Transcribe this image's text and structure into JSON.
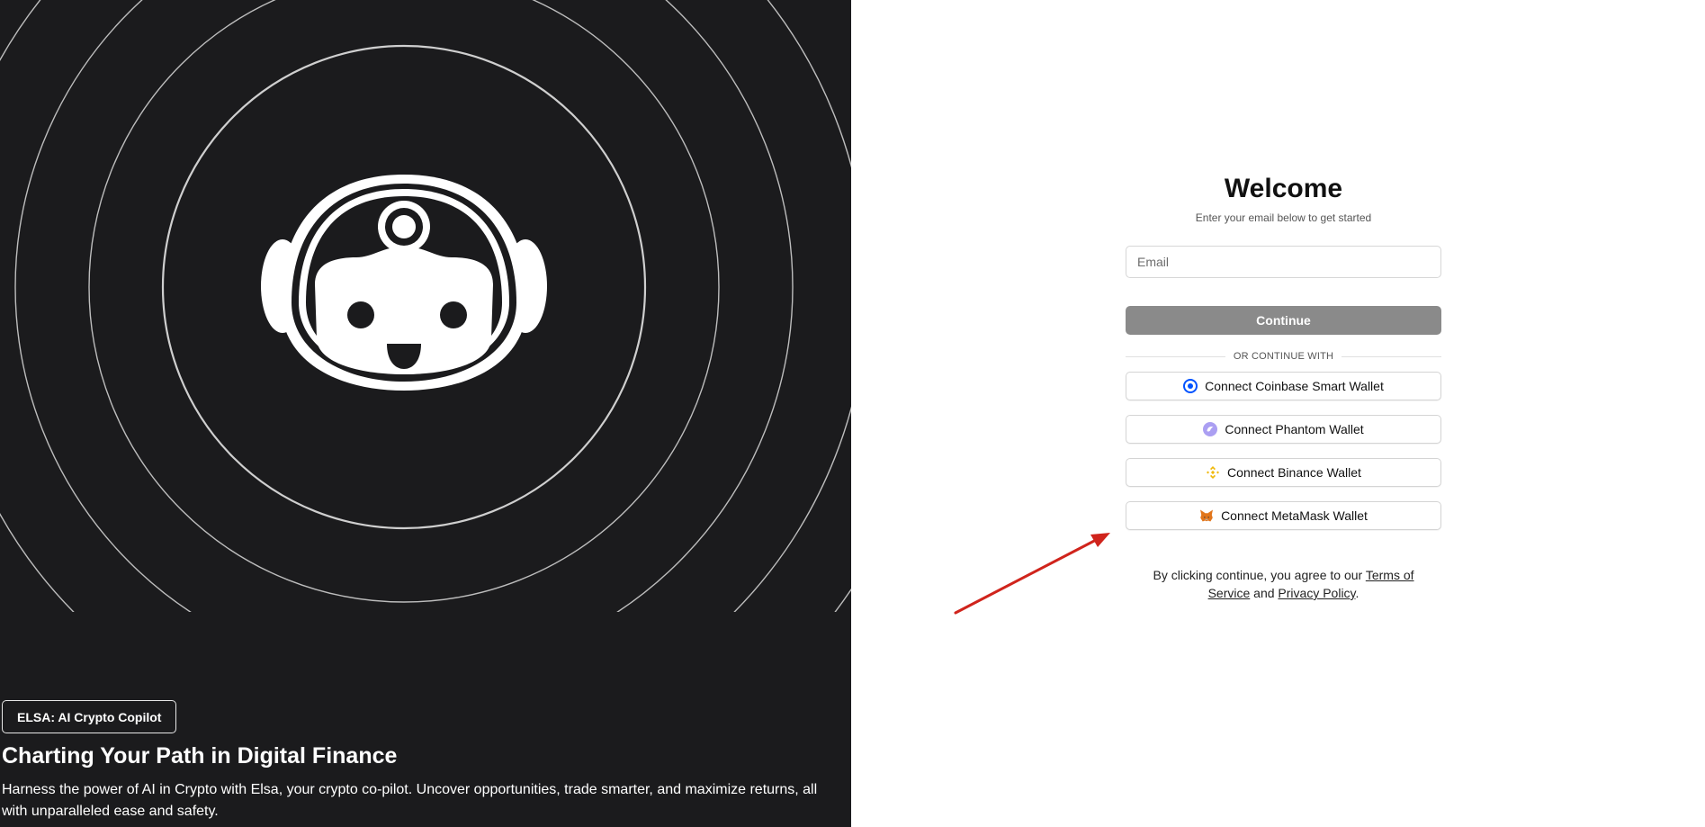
{
  "hero": {
    "badge": "ELSA: AI Crypto Copilot",
    "title": "Charting Your Path in Digital Finance",
    "description": "Harness the power of AI in Crypto with Elsa, your crypto co-pilot. Uncover opportunities, trade smarter, and maximize returns, all with unparalleled ease and safety."
  },
  "auth": {
    "title": "Welcome",
    "subtitle": "Enter your email below to get started",
    "email_placeholder": "Email",
    "continue_label": "Continue",
    "divider_label": "OR CONTINUE WITH",
    "wallets": [
      {
        "label": "Connect Coinbase Smart Wallet",
        "icon": "coinbase-icon"
      },
      {
        "label": "Connect Phantom Wallet",
        "icon": "phantom-icon"
      },
      {
        "label": "Connect Binance Wallet",
        "icon": "binance-icon"
      },
      {
        "label": "Connect MetaMask Wallet",
        "icon": "metamask-icon"
      }
    ],
    "legal": {
      "prefix": "By clicking continue, you agree to our",
      "terms": "Terms of Service",
      "and": "and",
      "privacy": "Privacy Policy",
      "suffix": "."
    }
  },
  "colors": {
    "left_background": "#1b1b1d",
    "continue_button": "#8a8a8a",
    "annotation_arrow": "#d0241c",
    "coinbase": "#0052ff",
    "phantom": "#ab9ff2",
    "binance": "#f0b90b",
    "metamask": "#e2761b"
  }
}
